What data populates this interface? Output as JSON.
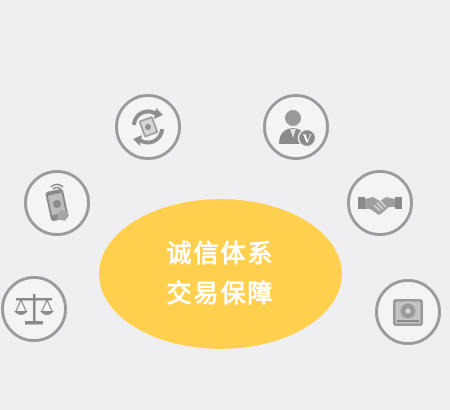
{
  "center": {
    "line1": "诚信体系",
    "line2": "交易保障"
  },
  "icons": [
    {
      "id": "exchange",
      "name": "money-exchange-icon"
    },
    {
      "id": "verified",
      "name": "verified-user-icon"
    },
    {
      "id": "phone",
      "name": "mobile-payment-icon"
    },
    {
      "id": "handshake",
      "name": "handshake-icon"
    },
    {
      "id": "scale",
      "name": "balance-scale-icon"
    },
    {
      "id": "drive",
      "name": "hard-drive-icon"
    }
  ],
  "colors": {
    "background": "#efeff1",
    "accent": "#ffcf4e",
    "icon_gray": "#9b9b9b"
  }
}
